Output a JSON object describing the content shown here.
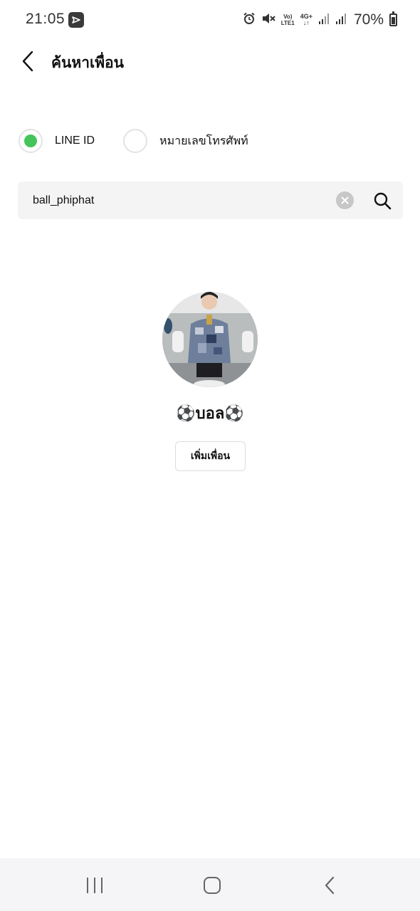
{
  "status_bar": {
    "time": "21:05",
    "app_icon": "line-notification-icon",
    "icons": [
      "alarm-icon",
      "mute-icon",
      "volte-icon",
      "4g-icon",
      "signal-icon",
      "signal-icon",
      "battery-icon"
    ],
    "volte_top": "Vo)",
    "volte_bottom": "LTE1",
    "network": "4G+",
    "battery_percent": "70%",
    "battery_level": 0.7
  },
  "header": {
    "back_icon": "chevron-left-icon",
    "title": "ค้นหาเพื่อน"
  },
  "search_type": {
    "options": [
      {
        "label": "LINE ID",
        "selected": true
      },
      {
        "label": "หมายเลขโทรศัพท์",
        "selected": false
      }
    ],
    "selected_color": "#44c45a"
  },
  "search": {
    "value": "ball_phiphat",
    "clear_icon": "clear-icon",
    "search_icon": "search-icon"
  },
  "result": {
    "name": "⚽บอล⚽",
    "add_friend_label": "เพิ่มเพื่อน"
  },
  "nav_bar": {
    "icons": [
      "recent-apps-icon",
      "home-icon",
      "back-icon"
    ]
  }
}
